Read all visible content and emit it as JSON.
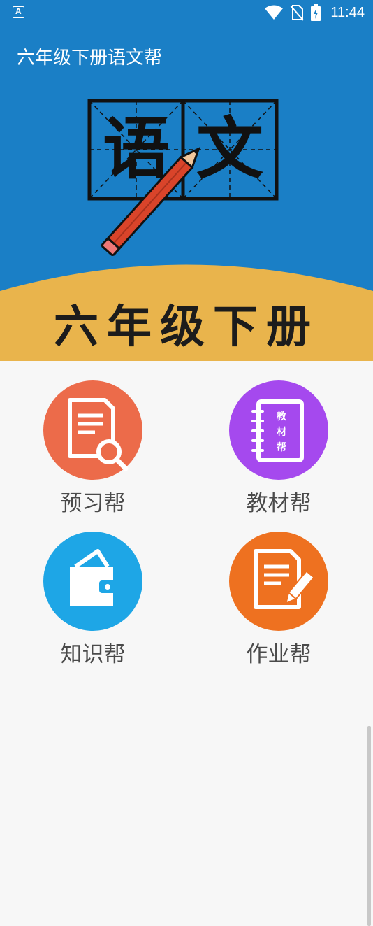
{
  "status_bar": {
    "time": "11:44",
    "icons": [
      "app-notification-icon",
      "wifi-icon",
      "no-sim-icon",
      "battery-icon"
    ]
  },
  "app_bar": {
    "title": "六年级下册语文帮"
  },
  "banner": {
    "grade_text": "六年级下册",
    "char_1": "语",
    "char_2": "文",
    "colors": {
      "top": "#1a7fc6",
      "bottom": "#e9b44c"
    }
  },
  "menu": {
    "items": [
      {
        "label": "预习帮",
        "icon": "document-search-icon",
        "color": "#ec6b4a"
      },
      {
        "label": "教材帮",
        "icon": "notebook-icon",
        "color": "#a549ee",
        "icon_text": [
          "教",
          "材",
          "帮"
        ]
      },
      {
        "label": "知识帮",
        "icon": "wallet-icon",
        "color": "#1ea6e6"
      },
      {
        "label": "作业帮",
        "icon": "document-edit-icon",
        "color": "#ee7120"
      }
    ]
  }
}
